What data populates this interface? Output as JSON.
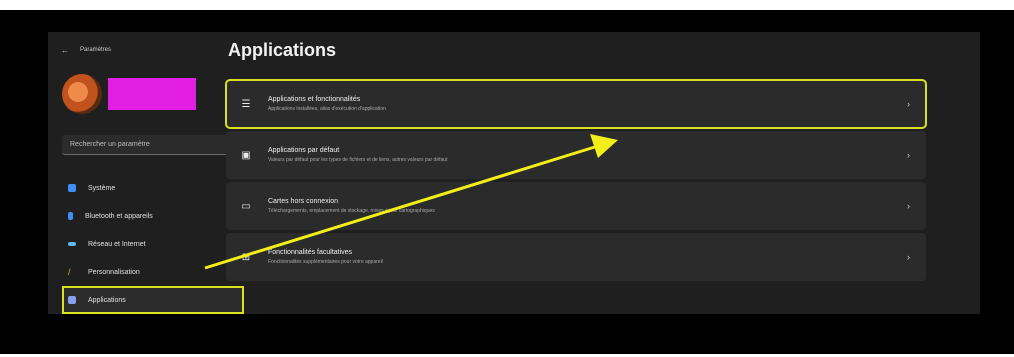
{
  "window": {
    "title": "Paramètres"
  },
  "search": {
    "placeholder": "Rechercher un paramètre"
  },
  "sidebar": {
    "items": [
      {
        "label": "Système",
        "icon": "monitor-icon",
        "color": "#3a8ef6",
        "active": false
      },
      {
        "label": "Bluetooth et appareils",
        "icon": "bluetooth-icon",
        "color": "#3a8ef6",
        "active": false
      },
      {
        "label": "Réseau et Internet",
        "icon": "wifi-icon",
        "color": "#5bb6f0",
        "active": false
      },
      {
        "label": "Personnalisation",
        "icon": "pen-icon",
        "color": "#e0a060",
        "active": false
      },
      {
        "label": "Applications",
        "icon": "apps-icon",
        "color": "#8a9ff0",
        "active": true
      }
    ]
  },
  "main": {
    "title": "Applications",
    "cards": [
      {
        "title": "Applications et fonctionnalités",
        "subtitle": "Applications installées, alias d'exécution d'application",
        "icon": "list-icon",
        "highlight": true
      },
      {
        "title": "Applications par défaut",
        "subtitle": "Valeurs par défaut pour les types de fichiers et de liens, autres valeurs par défaut",
        "icon": "default-apps-icon",
        "highlight": false
      },
      {
        "title": "Cartes hors connexion",
        "subtitle": "Téléchargements, emplacement de stockage, mises à jour cartographiques",
        "icon": "map-icon",
        "highlight": false
      },
      {
        "title": "Fonctionnalités facultatives",
        "subtitle": "Fonctionnalités supplémentaires pour votre appareil",
        "icon": "grid-plus-icon",
        "highlight": false
      }
    ]
  },
  "colors": {
    "highlight": "#d9e021",
    "arrow": "#f2ee1a",
    "username_block": "#e31ee3"
  }
}
